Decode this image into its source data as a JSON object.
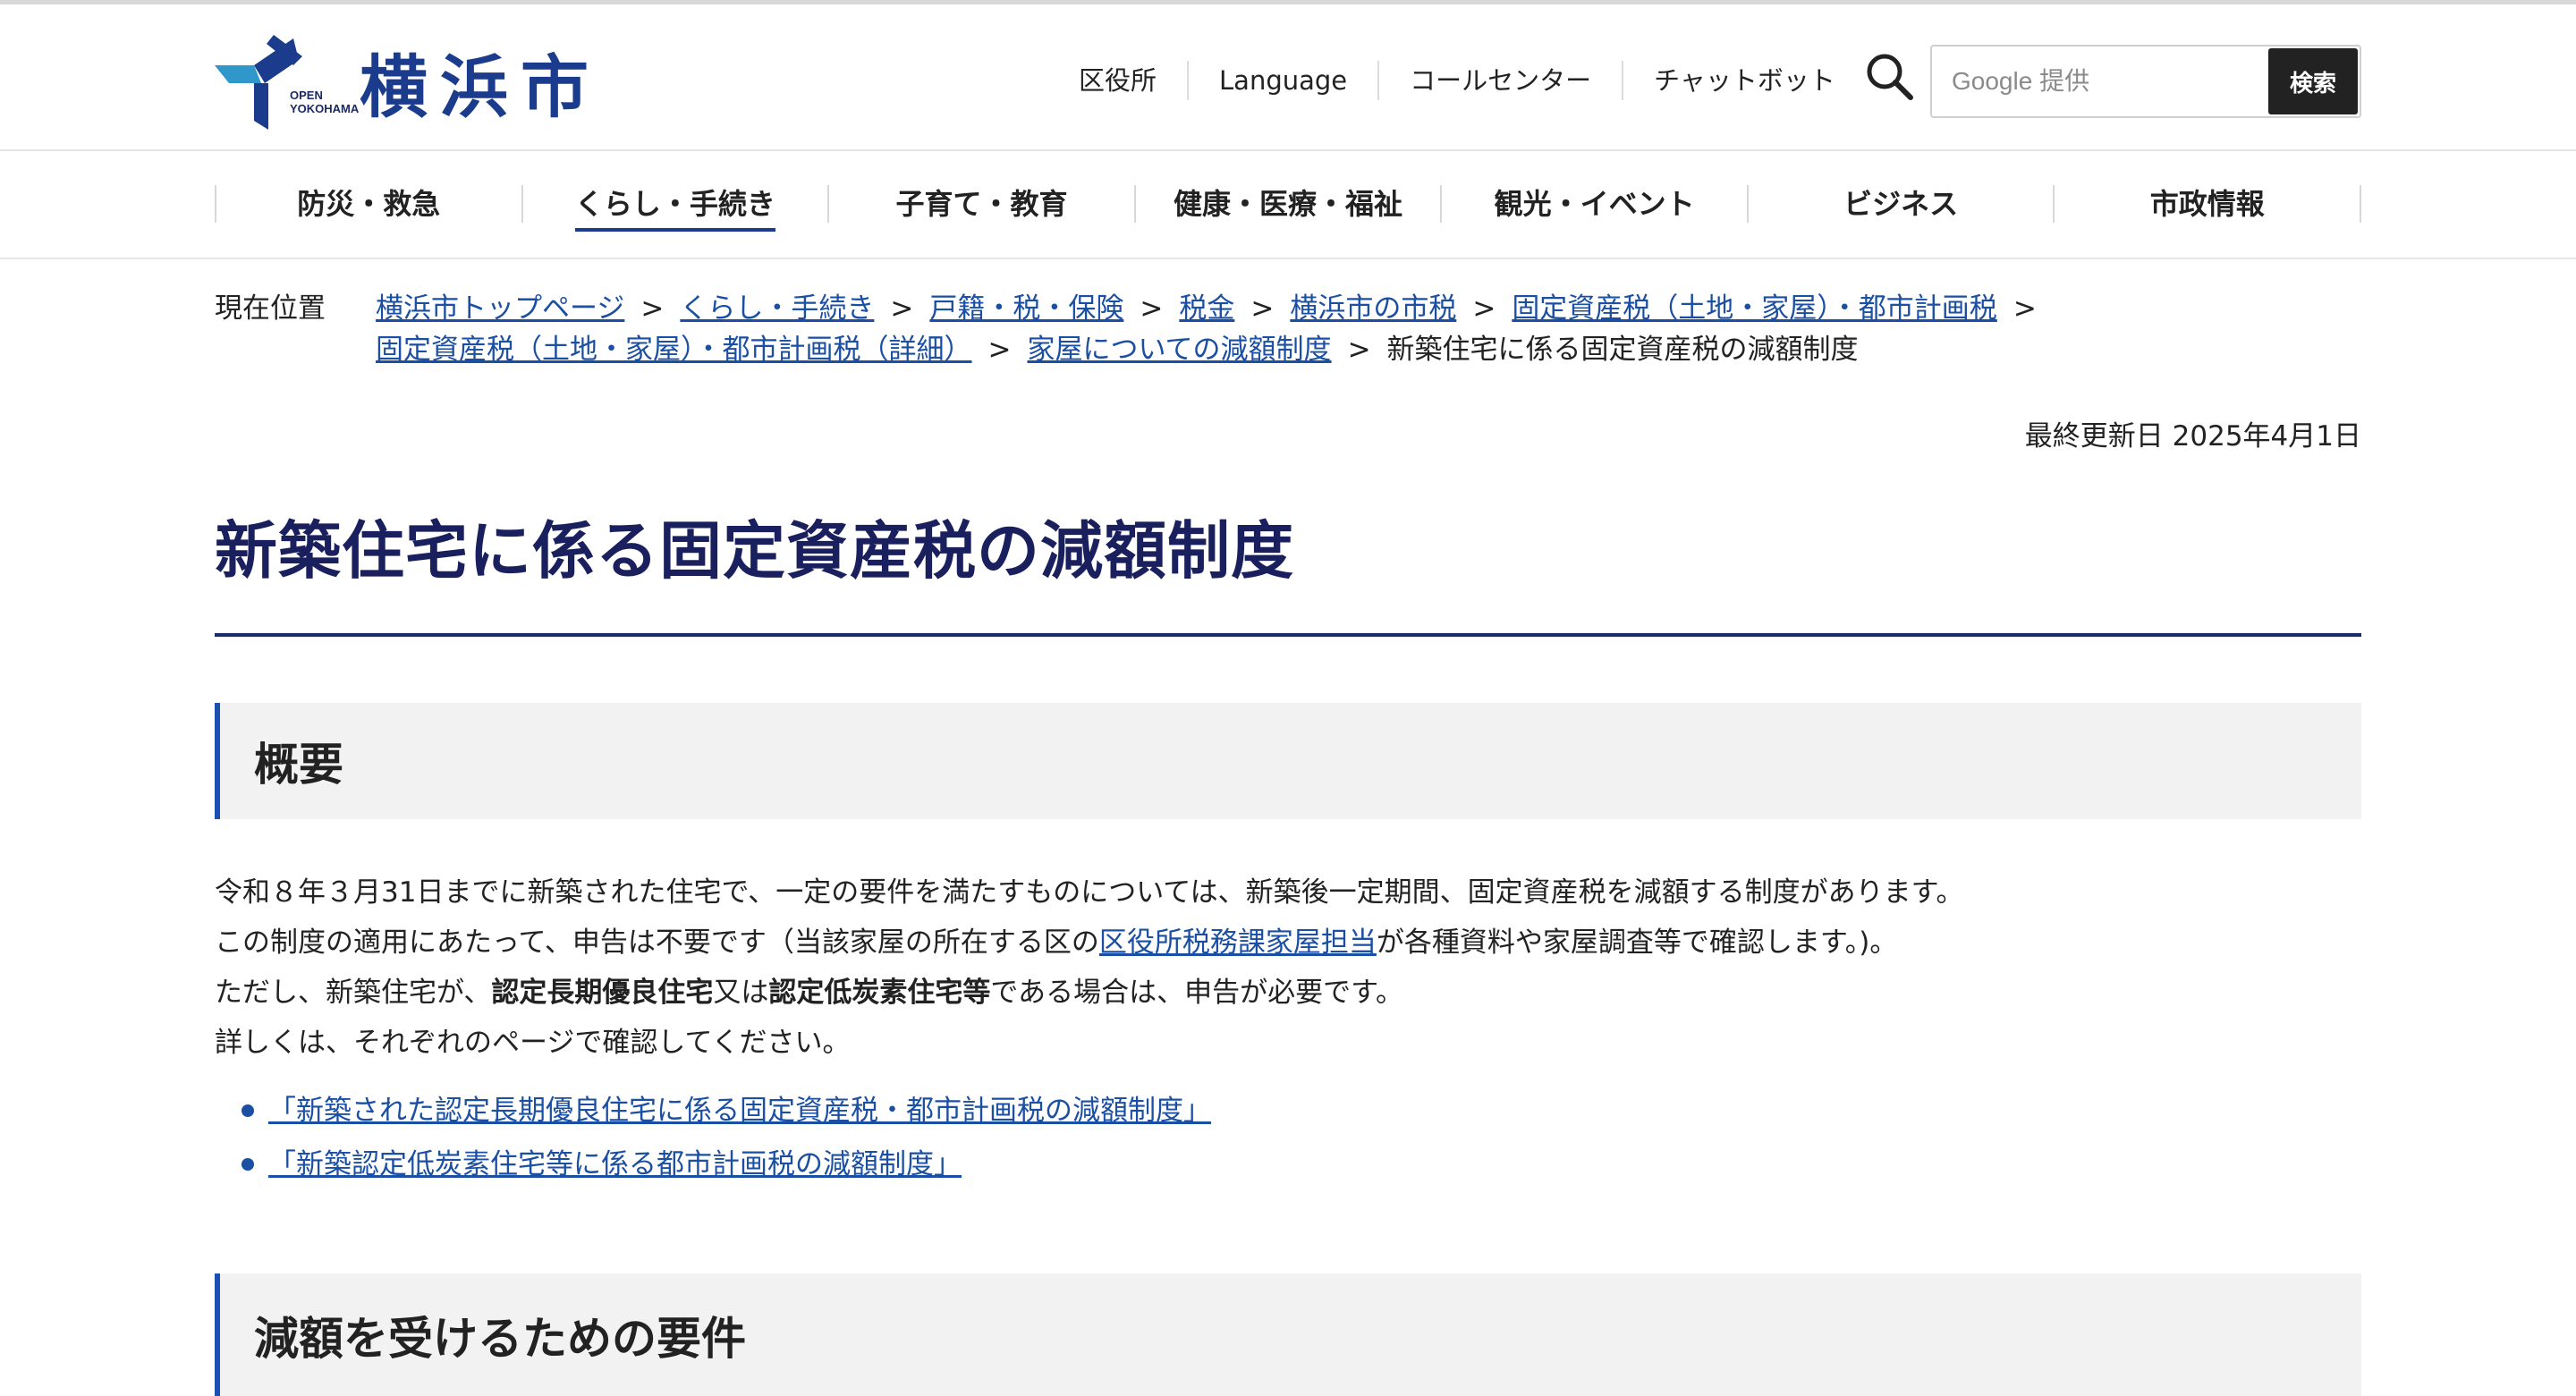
{
  "header": {
    "logo_small_line1": "OPEN",
    "logo_small_line2": "YOKOHAMA",
    "logo_text": "横浜市",
    "util_nav": [
      "区役所",
      "Language",
      "コールセンター",
      "チャットボット"
    ],
    "search": {
      "placeholder": "Google 提供",
      "button_label": "検索"
    }
  },
  "global_nav": [
    {
      "label": "防災・救急",
      "active": false
    },
    {
      "label": "くらし・手続き",
      "active": true
    },
    {
      "label": "子育て・教育",
      "active": false
    },
    {
      "label": "健康・医療・福祉",
      "active": false
    },
    {
      "label": "観光・イベント",
      "active": false
    },
    {
      "label": "ビジネス",
      "active": false
    },
    {
      "label": "市政情報",
      "active": false
    }
  ],
  "breadcrumb": {
    "label": "現在位置",
    "links": [
      "横浜市トップページ",
      "くらし・手続き",
      "戸籍・税・保険",
      "税金",
      "横浜市の市税",
      "固定資産税（土地・家屋）・都市計画税",
      "固定資産税（土地・家屋）・都市計画税（詳細）",
      "家屋についての減額制度"
    ],
    "separator": ">",
    "current": "新築住宅に係る固定資産税の減額制度"
  },
  "last_updated": "最終更新日 2025年4月1日",
  "page_title": "新築住宅に係る固定資産税の減額制度",
  "section1": {
    "heading": "概要",
    "p1": "令和８年３月31日までに新築された住宅で、一定の要件を満たすものについては、新築後一定期間、固定資産税を減額する制度があります。",
    "p2_before": "この制度の適用にあたって、申告は不要です（当該家屋の所在する区の",
    "p2_link": "区役所税務課家屋担当",
    "p2_after": "が各種資料や家屋調査等で確認します。)。",
    "p3_a": "ただし、新築住宅が、",
    "p3_b": "認定長期優良住宅",
    "p3_c": "又は",
    "p3_d": "認定低炭素住宅等",
    "p3_e": "である場合は、申告が必要です。",
    "p4": "詳しくは、それぞれのページで確認してください。",
    "links": [
      "「新築された認定長期優良住宅に係る固定資産税・都市計画税の減額制度」",
      "「新築認定低炭素住宅等に係る都市計画税の減額制度」"
    ]
  },
  "section2": {
    "heading": "減額を受けるための要件"
  },
  "colors": {
    "brand": "#1b3b8c",
    "link": "#1a4fa3",
    "title": "#1a1f5e",
    "section_bar": "#1b4fb0"
  }
}
